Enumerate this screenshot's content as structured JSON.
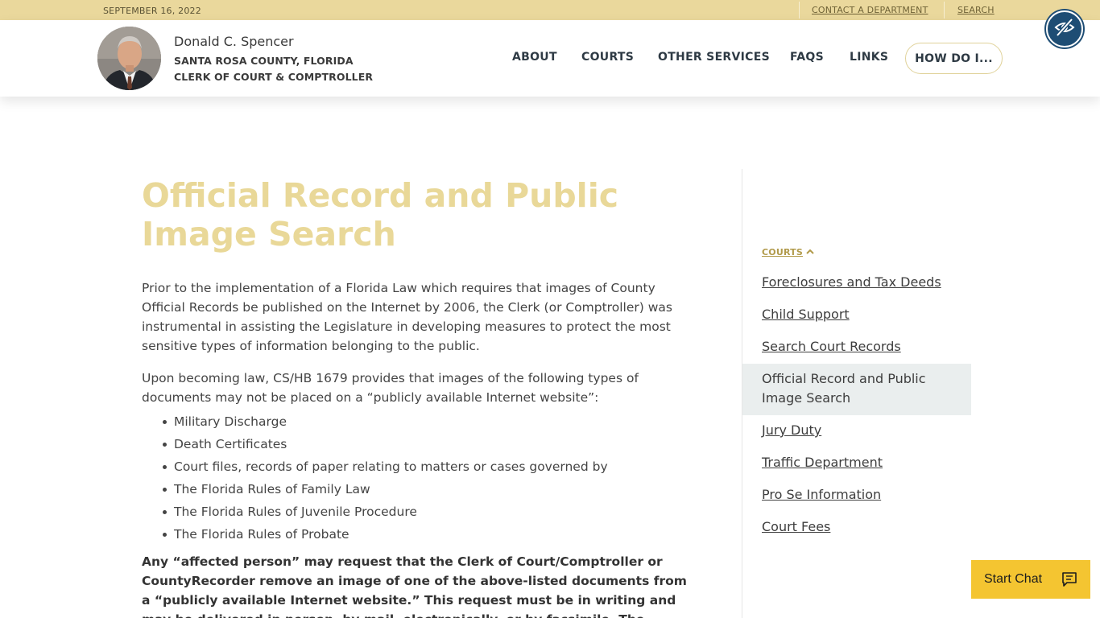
{
  "topbar": {
    "date": "SEPTEMBER 16, 2022",
    "contact": "CONTACT A DEPARTMENT",
    "search": "SEARCH"
  },
  "brand": {
    "name": "Donald C. Spencer",
    "line1": "SANTA ROSA COUNTY, FLORIDA",
    "line2": "CLERK OF COURT & COMPTROLLER"
  },
  "nav": {
    "items": [
      "ABOUT",
      "COURTS",
      "OTHER SERVICES",
      "FAQS",
      "LINKS"
    ],
    "howdo": "HOW DO I..."
  },
  "page": {
    "title": "Official Record and Public Image Search",
    "para1": "Prior to the implementation of a Florida Law which requires that images of County Official Records be published on the Internet by 2006, the Clerk (or Comptroller) was instrumental in assisting the Legislature in developing measures to protect the most sensitive types of information belonging to the public.",
    "para2": "Upon becoming law, CS/HB 1679 provides that images of the following types of documents may not be placed on a “publicly available Internet website”:",
    "bullets": [
      "Military Discharge",
      "Death Certificates",
      "Court files, records of paper relating to matters or cases governed by",
      "The Florida Rules of Family Law",
      "The Florida Rules of Juvenile Procedure",
      "The Florida Rules of Probate"
    ],
    "para3": "Any “affected person” may request that the Clerk of Court/Comptroller or CountyRecorder remove an image of one of the above-listed documents from a “publicly available Internet website.” This request must be in writing and may be delivered in person, by mail, electronically, or by facsimile. The request must"
  },
  "sidebar": {
    "heading": "COURTS",
    "items": [
      "Foreclosures and Tax Deeds",
      "Child Support",
      "Search Court Records",
      "Official Record and Public Image Search",
      "Jury Duty",
      "Traffic Department",
      "Pro Se Information",
      "Court Fees"
    ],
    "active_index": 3
  },
  "chat": {
    "label": "Start Chat"
  },
  "colors": {
    "topbar_bg": "#ead89c",
    "title": "#e9d898",
    "nav_text": "#2e3a44",
    "a11y_button": "#1e4d74",
    "chat_button": "#f4c531",
    "sidebar_active": "#eaeeee"
  },
  "icons": {
    "a11y": "eye-slash-icon",
    "sidebar_heading": "chevron-up-icon",
    "chat": "chat-bubble-icon"
  }
}
